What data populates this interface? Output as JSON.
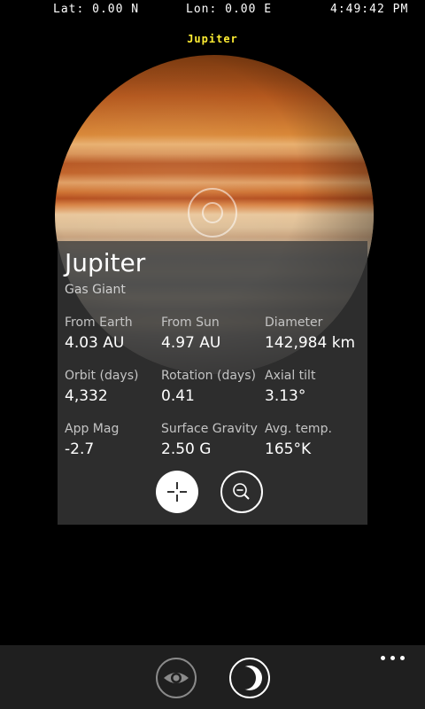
{
  "status_bar": {
    "latitude": "Lat: 0.00 N",
    "longitude": "Lon: 0.00 E",
    "time": "4:49:42 PM"
  },
  "object_name": "Jupiter",
  "info_panel": {
    "title": "Jupiter",
    "subtitle": "Gas Giant",
    "stats": [
      {
        "label": "From Earth",
        "value": "4.03 AU"
      },
      {
        "label": "From Sun",
        "value": "4.97 AU"
      },
      {
        "label": "Diameter",
        "value": "142,984 km"
      },
      {
        "label": "Orbit (days)",
        "value": "4,332"
      },
      {
        "label": "Rotation (days)",
        "value": "0.41"
      },
      {
        "label": "Axial tilt",
        "value": "3.13°"
      },
      {
        "label": "App Mag",
        "value": "-2.7"
      },
      {
        "label": "Surface Gravity",
        "value": "2.50 G"
      },
      {
        "label": "Avg. temp.",
        "value": "165°K"
      }
    ],
    "buttons": {
      "center": "crosshair-icon",
      "zoom_out": "zoom-out-icon"
    }
  },
  "app_bar": {
    "buttons": [
      "eye-icon",
      "moon-phase-icon"
    ],
    "more": "ellipsis-icon"
  },
  "colors": {
    "object_name": "#ffee33",
    "panel_bg": "#3a3a3a",
    "app_bar_bg": "#1f1f1f"
  }
}
